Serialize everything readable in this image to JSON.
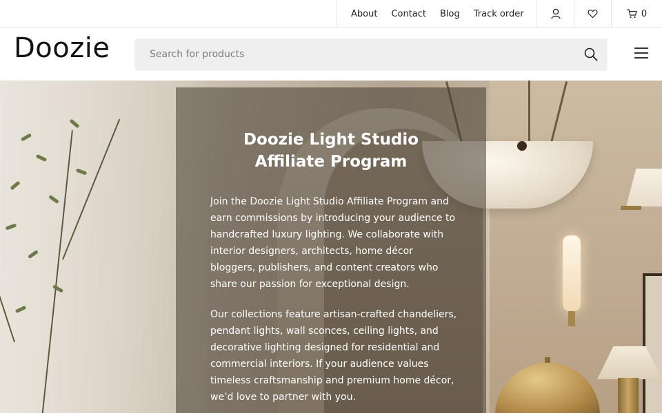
{
  "topbar": {
    "links": [
      {
        "label": "About"
      },
      {
        "label": "Contact"
      },
      {
        "label": "Blog"
      },
      {
        "label": "Track order"
      }
    ],
    "icons": {
      "account": "user-icon",
      "wishlist": "heart-icon",
      "cart": "cart-icon"
    },
    "cart_count": "0"
  },
  "header": {
    "logo": "Doozie",
    "search": {
      "placeholder": "Search for products",
      "value": ""
    },
    "menu_icon": "hamburger-menu-icon"
  },
  "hero": {
    "title_line1": "Doozie Light Studio",
    "title_line2": "Affiliate Program",
    "paragraphs": [
      "Join the Doozie Light Studio Affiliate Program and earn commissions by introducing your audience to handcrafted luxury lighting. We collaborate with interior designers, architects, home décor bloggers, publishers, and content creators who share our passion for exceptional design.",
      "Our collections feature artisan-crafted chandeliers, pendant lights, wall sconces, ceiling lights, and decorative lighting designed for residential and commercial interiors. If your audience values timeless craftsmanship and premium home décor, we’d love to partner with you."
    ]
  }
}
